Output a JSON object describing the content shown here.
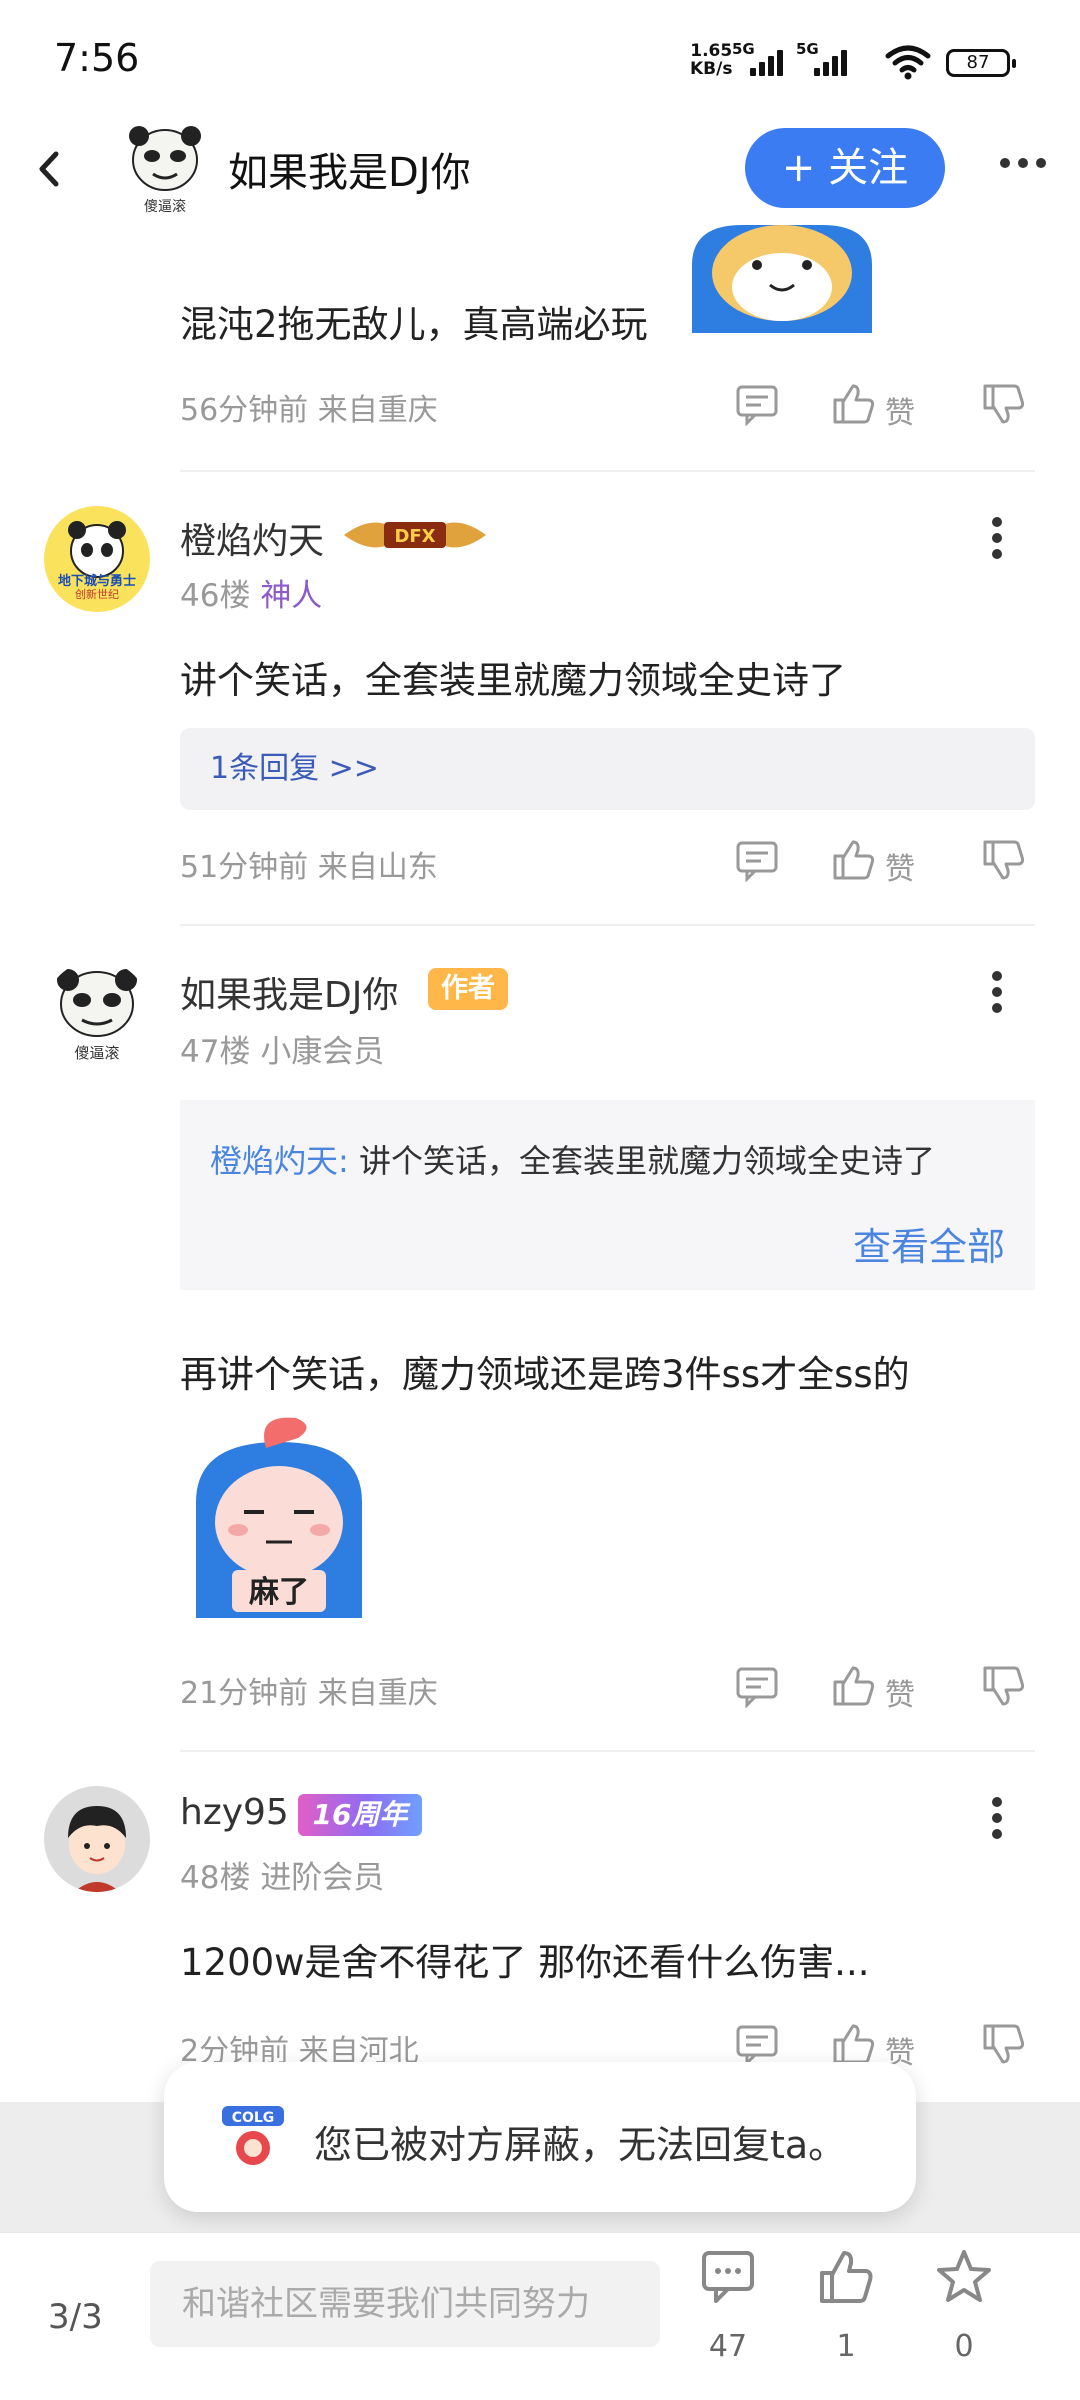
{
  "status": {
    "time": "7:56",
    "net_speed_value": "1.65",
    "net_speed_unit": "KB/s",
    "sig1": "5G",
    "sig2": "5G",
    "battery": "87"
  },
  "header": {
    "title": "如果我是DJ你",
    "avatar_caption": "傻逼滚",
    "follow_label": "+ 关注"
  },
  "like_label": "赞",
  "post_top": {
    "text": "混沌2拖无敌儿，真高端必玩",
    "meta": "56分钟前 来自重庆"
  },
  "post46": {
    "username": "橙焰灼天",
    "badge_text": "DFX",
    "avatar_text": "地下城与勇士",
    "avatar_sub": "创新世纪",
    "floor": "46楼",
    "rank": "神人",
    "text": "讲个笑话，全套装里就魔力领域全史诗了",
    "reply_link": "1条回复 >>",
    "meta": "51分钟前 来自山东"
  },
  "post47": {
    "username": "如果我是DJ你",
    "author_badge": "作者",
    "avatar_caption": "傻逼滚",
    "floor": "47楼",
    "rank": "小康会员",
    "quote_user": "橙焰灼天:",
    "quote_text": "讲个笑话，全套装里就魔力领域全史诗了",
    "view_all": "查看全部",
    "text": "再讲个笑话，魔力领域还是跨3件ss才全ss的",
    "sticker_text": "麻了",
    "meta": "21分钟前 来自重庆"
  },
  "post48": {
    "username": "hzy95",
    "badge": "16周年",
    "floor": "48楼",
    "rank": "进阶会员",
    "text": "1200w是舍不得花了 那你还看什么伤害...",
    "meta": "2分钟前 来自河北"
  },
  "toast": {
    "logo_text": "COLG",
    "message": "您已被对方屏蔽，无法回复ta。"
  },
  "bottom": {
    "pager": "3/3",
    "placeholder": "和谐社区需要我们共同努力",
    "comments": "47",
    "likes": "1",
    "favorites": "0"
  }
}
